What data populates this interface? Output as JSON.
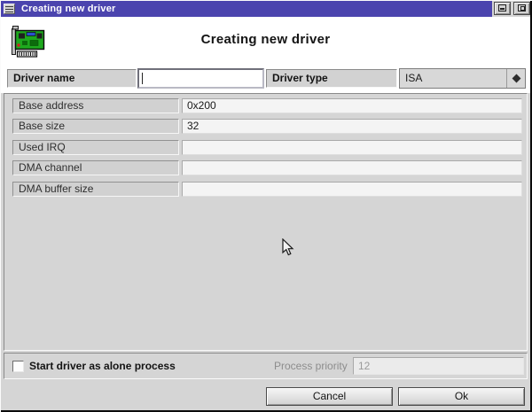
{
  "window": {
    "title": "Creating new driver",
    "controls": {
      "minimize": "minimize",
      "maximize": "maximize"
    }
  },
  "dialog": {
    "heading": "Creating new driver",
    "icon": "network-card-icon"
  },
  "form": {
    "driver_name": {
      "label": "Driver name",
      "value": ""
    },
    "driver_type": {
      "label": "Driver type",
      "value": "ISA"
    }
  },
  "properties": {
    "rows": [
      {
        "label": "Base address",
        "value": "0x200"
      },
      {
        "label": "Base size",
        "value": "32"
      },
      {
        "label": "Used IRQ",
        "value": ""
      },
      {
        "label": "DMA channel",
        "value": ""
      },
      {
        "label": "DMA buffer size",
        "value": ""
      }
    ]
  },
  "options": {
    "alone_process": {
      "label": "Start driver as alone process",
      "checked": false
    },
    "process_priority": {
      "label": "Process priority",
      "value": "12",
      "enabled": false
    }
  },
  "buttons": {
    "cancel": "Cancel",
    "ok": "Ok"
  },
  "colors": {
    "titlebar": "#4b44ae",
    "window_bg": "#d5d5d5",
    "field_bg": "#f4f4f4",
    "card_green": "#1ea81e"
  }
}
